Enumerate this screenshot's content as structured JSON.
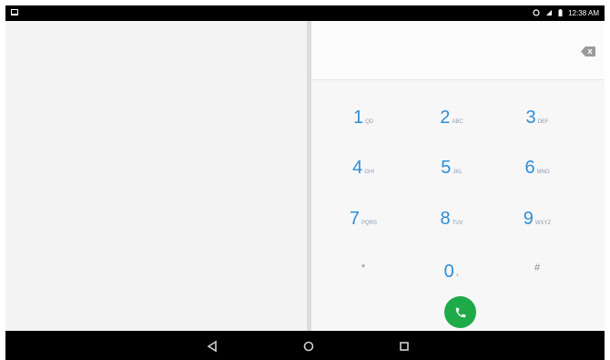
{
  "status_bar": {
    "left_icon": "notification-icon",
    "right_icons": [
      "alarm-icon",
      "wifi-icon",
      "battery-icon"
    ],
    "time": "12:38 AM"
  },
  "dialer": {
    "digits_value": "",
    "backspace_icon": "backspace-icon",
    "keys": [
      {
        "digit": "1",
        "letters": "QD"
      },
      {
        "digit": "2",
        "letters": "ABC"
      },
      {
        "digit": "3",
        "letters": "DEF"
      },
      {
        "digit": "4",
        "letters": "GHI"
      },
      {
        "digit": "5",
        "letters": "JKL"
      },
      {
        "digit": "6",
        "letters": "MNO"
      },
      {
        "digit": "7",
        "letters": "PQRS"
      },
      {
        "digit": "8",
        "letters": "TUV"
      },
      {
        "digit": "9",
        "letters": "WXYZ"
      },
      {
        "digit": "*",
        "letters": ""
      },
      {
        "digit": "0",
        "letters": "+"
      },
      {
        "digit": "#",
        "letters": ""
      }
    ],
    "call_icon": "phone-icon",
    "call_color": "#1faa49",
    "digit_color": "#2b8ed8"
  },
  "nav_bar": {
    "back_icon": "back-icon",
    "home_icon": "home-icon",
    "recents_icon": "recents-icon"
  }
}
